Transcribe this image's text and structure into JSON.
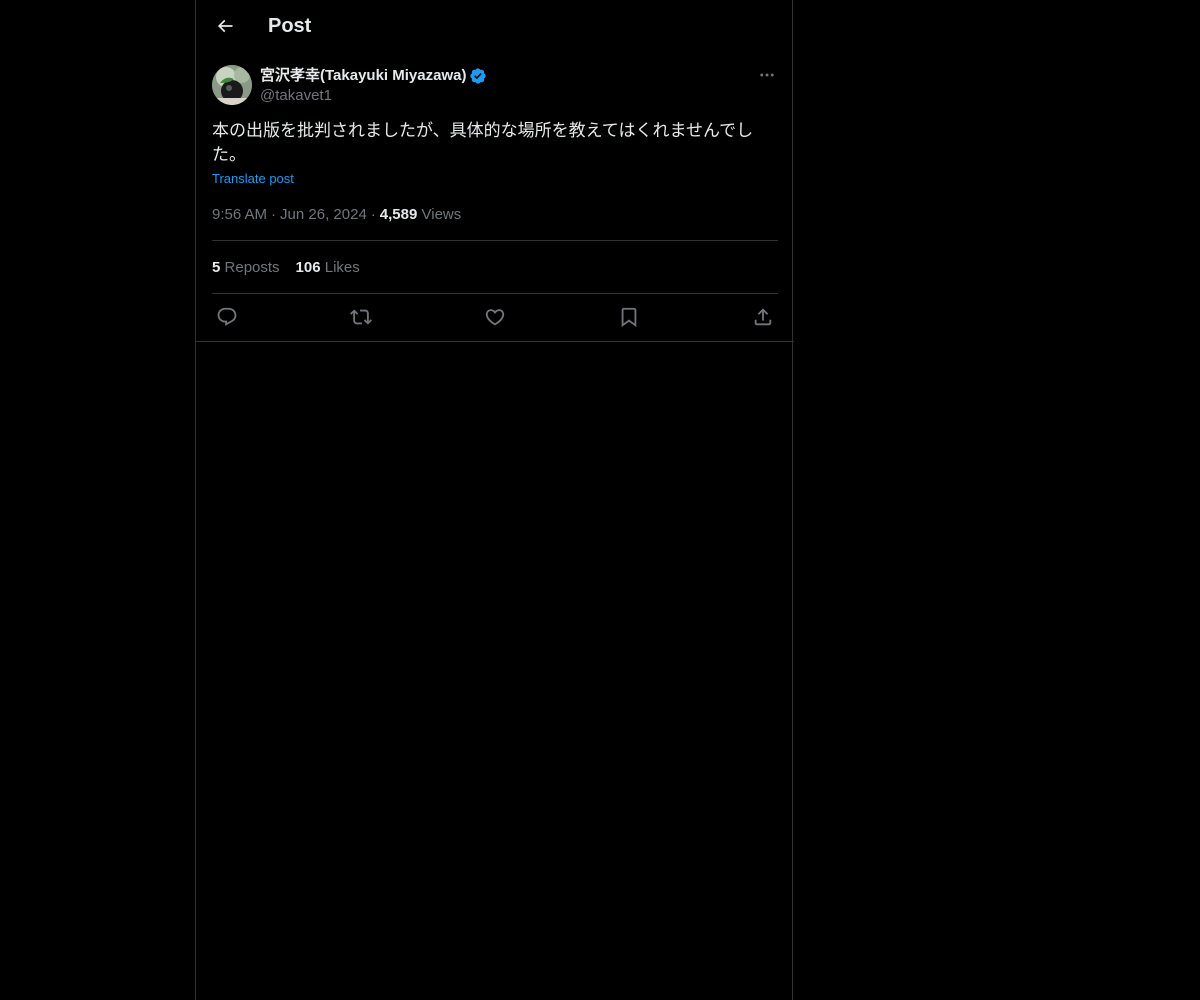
{
  "header": {
    "back_icon": "arrow-left-icon",
    "title": "Post"
  },
  "post": {
    "author": {
      "display_name": "宮沢孝幸(Takayuki Miyazawa)",
      "handle": "@takavet1",
      "verified": true,
      "verified_color": "#1d9bf0"
    },
    "text": "本の出版を批判されましたが、具体的な場所を教えてはくれませんでした。",
    "translate_label": "Translate post",
    "time": "9:56 AM",
    "separator": "·",
    "date": "Jun 26, 2024",
    "views_count": "4,589",
    "views_label": "Views",
    "reposts_count": "5",
    "reposts_label": "Reposts",
    "likes_count": "106",
    "likes_label": "Likes"
  },
  "actions": [
    {
      "icon": "reply-icon"
    },
    {
      "icon": "repost-icon"
    },
    {
      "icon": "like-icon"
    },
    {
      "icon": "bookmark-icon"
    },
    {
      "icon": "share-icon"
    }
  ],
  "colors": {
    "background": "#000000",
    "text_primary": "#e7e9ea",
    "text_secondary": "#71767b",
    "accent": "#1d9bf0",
    "border": "#2f3336"
  }
}
